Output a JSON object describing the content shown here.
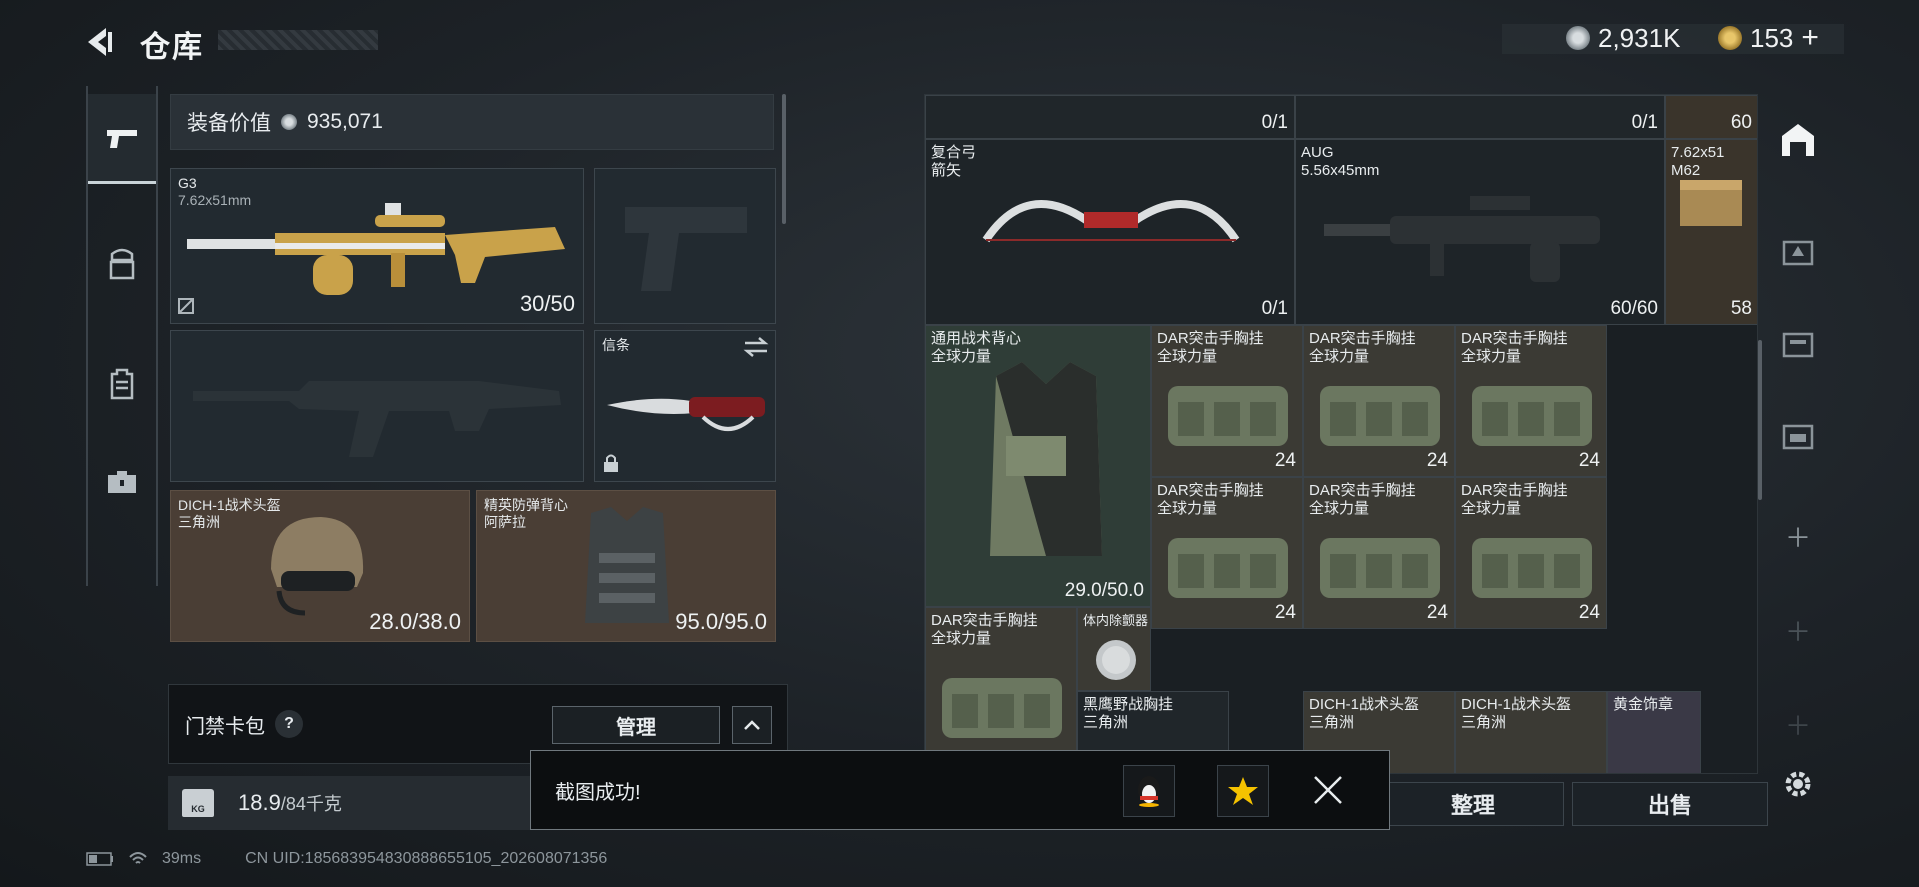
{
  "header": {
    "title": "仓库",
    "currency_1": "2,931K",
    "currency_2": "153",
    "add_symbol": "+"
  },
  "nav": {
    "items": [
      {
        "name": "weapons",
        "icon": "pistol-icon",
        "active": true
      },
      {
        "name": "armor",
        "icon": "helmet-armor-icon",
        "active": false
      },
      {
        "name": "backpack",
        "icon": "backpack-icon",
        "active": false
      },
      {
        "name": "toolbox",
        "icon": "toolbox-icon",
        "active": false
      }
    ]
  },
  "loadout": {
    "value_label": "装备价值",
    "value": "935,071",
    "slots": [
      {
        "name": "G3",
        "sub": "7.62x51mm",
        "count": "30/50"
      },
      {
        "name": "信条",
        "sub": "",
        "count": ""
      },
      {
        "name": "DICH-1战术头盔",
        "sub": "三角洲",
        "count": "28.0/38.0"
      },
      {
        "name": "精英防弹背心",
        "sub": "阿萨拉",
        "count": "95.0/95.0"
      }
    ],
    "keycard_label": "门禁卡包",
    "help": "?",
    "manage_label": "管理",
    "weight_value": "18.9",
    "weight_max": "/84千克",
    "kg_label": "KG"
  },
  "status": {
    "ping": "39ms",
    "uid": "CN UID:185683954830888655105_202608071356"
  },
  "storage": {
    "top_counts": [
      "0/1",
      "0/1",
      "60"
    ],
    "items": [
      {
        "name": "复合弓",
        "sub": "箭矢",
        "count": "0/1"
      },
      {
        "name": "AUG",
        "sub": "5.56x45mm",
        "count": "60/60"
      },
      {
        "name": "7.62x51",
        "sub": "M62",
        "count": "58"
      },
      {
        "name": "通用战术背心",
        "sub": "全球力量",
        "count": "29.0/50.0"
      },
      {
        "name": "DAR突击手胸挂",
        "sub": "全球力量",
        "count": "24"
      },
      {
        "name": "DAR突击手胸挂",
        "sub": "全球力量",
        "count": "24"
      },
      {
        "name": "DAR突击手胸挂",
        "sub": "全球力量",
        "count": "24"
      },
      {
        "name": "DAR突击手胸挂",
        "sub": "全球力量",
        "count": "24"
      },
      {
        "name": "DAR突击手胸挂",
        "sub": "全球力量",
        "count": "24"
      },
      {
        "name": "DAR突击手胸挂",
        "sub": "全球力量",
        "count": "24"
      },
      {
        "name": "DAR突击手胸挂",
        "sub": "全球力量",
        "count": ""
      },
      {
        "name": "体内除颤器",
        "sub": "",
        "count": ""
      },
      {
        "name": "黑鹰野战胸挂",
        "sub": "三角洲",
        "count": ""
      },
      {
        "name": "DICH-1战术头盔",
        "sub": "三角洲",
        "count": ""
      },
      {
        "name": "DICH-1战术头盔",
        "sub": "三角洲",
        "count": ""
      },
      {
        "name": "黄金饰章",
        "sub": "",
        "count": ""
      }
    ],
    "sort_label": "整理",
    "sell_label": "出售"
  },
  "toast": {
    "message": "截图成功!"
  },
  "colors": {
    "brown_slot": "#4a3e35",
    "green_slot": "#2d3b35",
    "accent_gold": "#c9a24a"
  }
}
